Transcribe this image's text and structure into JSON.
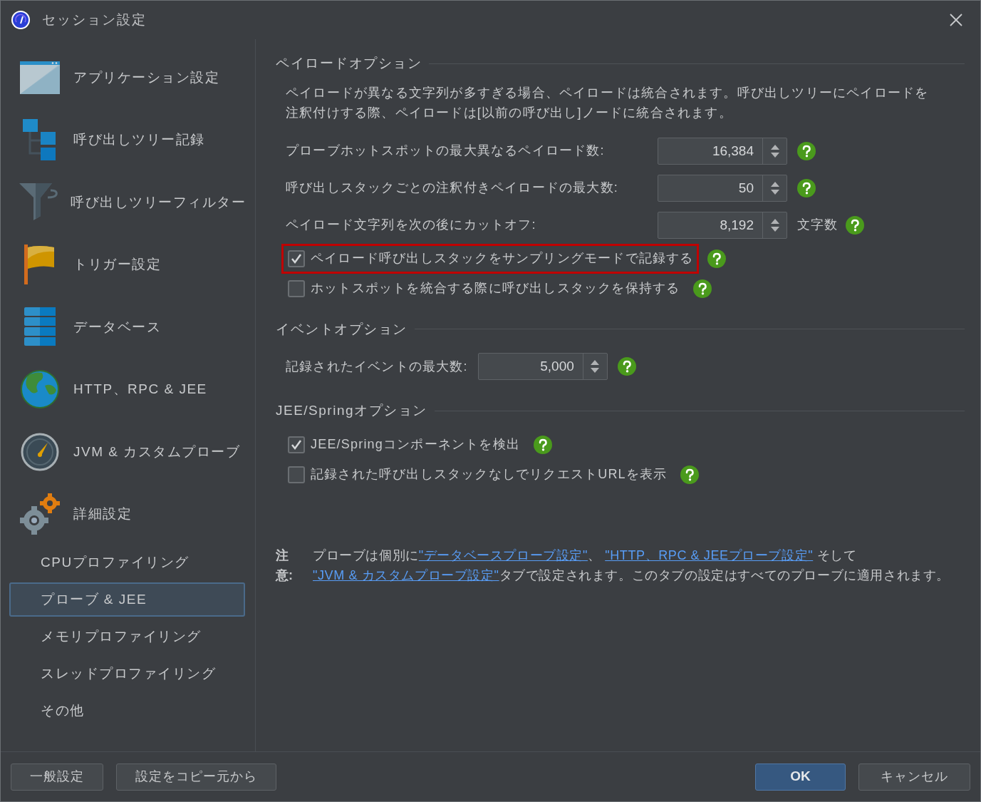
{
  "window": {
    "title": "セッション設定"
  },
  "sidebar": {
    "items": [
      {
        "label": "アプリケーション設定",
        "kind": "window",
        "selected": false
      },
      {
        "label": "呼び出しツリー記録",
        "kind": "tree",
        "selected": false
      },
      {
        "label": "呼び出しツリーフィルター",
        "kind": "funnel",
        "selected": false
      },
      {
        "label": "トリガー設定",
        "kind": "flag",
        "selected": false
      },
      {
        "label": "データベース",
        "kind": "database",
        "selected": false
      },
      {
        "label": "HTTP、RPC & JEE",
        "kind": "globe",
        "selected": false
      },
      {
        "label": "JVM & カスタムプローブ",
        "kind": "gauge",
        "selected": false
      },
      {
        "label": "詳細設定",
        "kind": "gears",
        "selected": false,
        "children": [
          {
            "label": "CPUプロファイリング",
            "selected": false
          },
          {
            "label": "プローブ & JEE",
            "selected": true
          },
          {
            "label": "メモリプロファイリング",
            "selected": false
          },
          {
            "label": "スレッドプロファイリング",
            "selected": false
          },
          {
            "label": "その他",
            "selected": false
          }
        ]
      }
    ]
  },
  "sections": [
    {
      "title": "ペイロードオプション",
      "description": "ペイロードが異なる文字列が多すぎる場合、ペイロードは統合されます。呼び出しツリーにペイロードを注釈付けする際、ペイロードは[以前の呼び出し]ノードに統合されます。",
      "rows": [
        {
          "kind": "spinner",
          "label": "プローブホットスポットの最大異なるペイロード数:",
          "value": "16,384"
        },
        {
          "kind": "spinner",
          "label": "呼び出しスタックごとの注釈付きペイロードの最大数:",
          "value": "50"
        },
        {
          "kind": "spinner",
          "label": "ペイロード文字列を次の後にカットオフ:",
          "value": "8,192",
          "unit": "文字数"
        },
        {
          "kind": "checkbox",
          "label": "ペイロード呼び出しスタックをサンプリングモードで記録する",
          "checked": true,
          "highlighted": true
        },
        {
          "kind": "checkbox",
          "label": "ホットスポットを統合する際に呼び出しスタックを保持する",
          "checked": false,
          "highlighted": false
        }
      ]
    },
    {
      "title": "イベントオプション",
      "rows": [
        {
          "kind": "spinner",
          "label": "記録されたイベントの最大数:",
          "value": "5,000"
        }
      ]
    },
    {
      "title": "JEE/Springオプション",
      "rows": [
        {
          "kind": "checkbox",
          "label": "JEE/Springコンポーネントを検出",
          "checked": true,
          "highlighted": false
        },
        {
          "kind": "checkbox",
          "label": "記録された呼び出しスタックなしでリクエストURLを表示",
          "checked": false,
          "highlighted": false
        }
      ]
    }
  ],
  "note": {
    "label": "注意:",
    "parts": [
      {
        "kind": "text",
        "text": "プローブは個別に"
      },
      {
        "kind": "link",
        "text": "\"データベースプローブ設定\""
      },
      {
        "kind": "text",
        "text": "、 "
      },
      {
        "kind": "link",
        "text": "\"HTTP、RPC & JEEプローブ設定\""
      },
      {
        "kind": "text",
        "text": " そして "
      },
      {
        "kind": "link",
        "text": "\"JVM & カスタムプローブ設定\""
      },
      {
        "kind": "text",
        "text": "タブで設定されます。このタブの設定はすべてのプローブに適用されます。"
      }
    ]
  },
  "footer": {
    "left_buttons": [
      "一般設定",
      "設定をコピー元から"
    ],
    "ok": "OK",
    "cancel": "キャンセル"
  }
}
